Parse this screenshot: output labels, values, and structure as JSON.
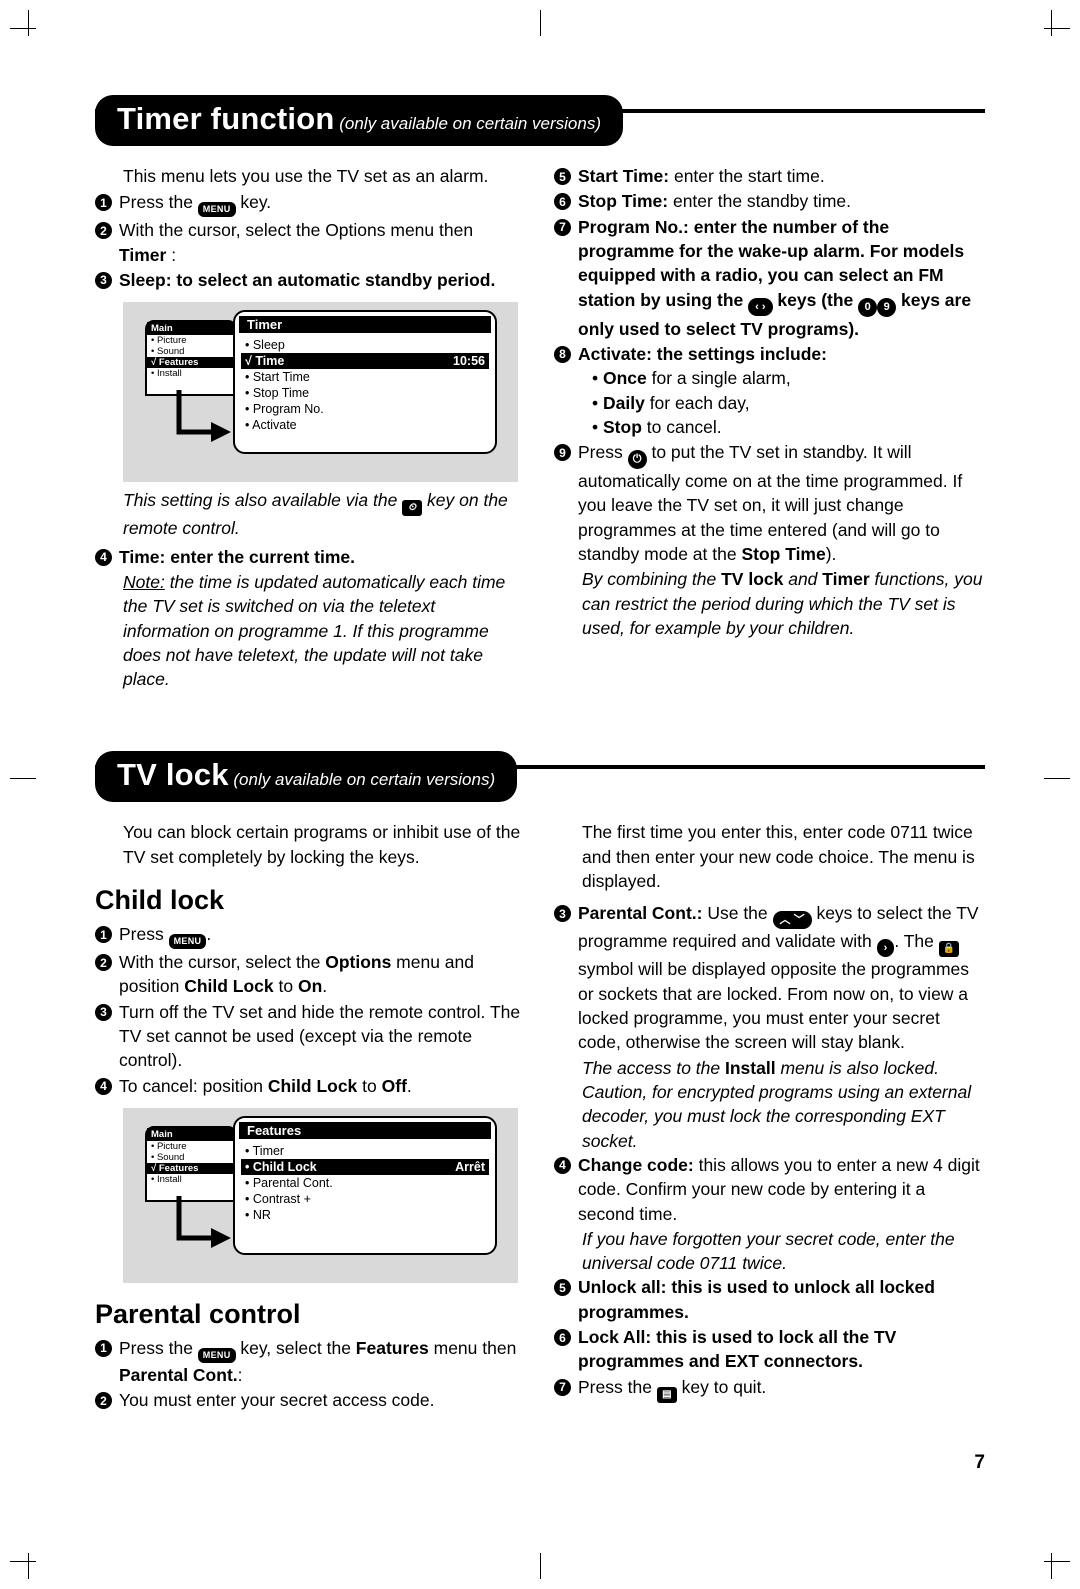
{
  "page": {
    "number": "7"
  },
  "timer": {
    "banner_title": "Timer function",
    "banner_sub": " (only available on certain versions)",
    "left": {
      "intro": "This menu lets you use the TV set as an alarm.",
      "step1_pre": "Press the ",
      "step1_key": "MENU",
      "step1_post": " key.",
      "step2": "With the cursor, select the Options menu then",
      "step2_bold": "Timer",
      "step2_colon": " :",
      "step3_bold": "Sleep:",
      "step3_rest": " to select an automatic standby period.",
      "osd": {
        "left_header": "Main",
        "left_rows": [
          "• Picture",
          "• Sound",
          "√ Features",
          "• Install"
        ],
        "left_selected_index": 2,
        "right_header": "Timer",
        "right_rows": [
          {
            "label": "• Sleep",
            "value": "",
            "selected": false
          },
          {
            "label": "√ Time",
            "value": "10:56",
            "selected": true
          },
          {
            "label": "• Start Time",
            "value": "",
            "selected": false
          },
          {
            "label": "• Stop Time",
            "value": "",
            "selected": false
          },
          {
            "label": "• Program No.",
            "value": "",
            "selected": false
          },
          {
            "label": "• Activate",
            "value": "",
            "selected": false
          }
        ]
      },
      "note_italic_1": "This setting is also available via the ",
      "note_italic_2": " key on the remote control.",
      "step4_bold": "Time:",
      "step4_rest": " enter the current time.",
      "note_label": "Note:",
      "note_text": " the time is updated automatically each time the TV set is switched on via the teletext information on programme 1. If this programme does not have teletext, the update will not take place."
    },
    "right": {
      "step5_bold": "Start Time:",
      "step5_rest": " enter the start time.",
      "step6_bold": "Stop Time:",
      "step6_rest": " enter the standby time.",
      "step7_bold": "Program No.:",
      "step7_rest_a": " enter the number of the programme for the wake-up alarm. For models equipped with a radio, you can select an FM station by using the ",
      "step7_rest_b": " keys (the ",
      "step7_key_0": "0",
      "step7_key_9": "9",
      "step7_rest_c": " keys are only used to select TV programs).",
      "step8_bold": "Activate:",
      "step8_rest": " the settings include:",
      "step8_b1_bold": "Once",
      "step8_b1_rest": " for a single alarm,",
      "step8_b2_bold": "Daily",
      "step8_b2_rest": " for each day,",
      "step8_b3_bold": "Stop",
      "step8_b3_rest": " to cancel.",
      "step9_pre": "Press ",
      "step9_post_a": " to put the TV set in standby. It will automatically come on at the time programmed. If you leave the TV set on, it will just change programmes at the time entered (and will go to standby mode at the ",
      "step9_bold": "Stop Time",
      "step9_post_b": ").",
      "closing_a": "By combining the ",
      "closing_b1": "TV lock",
      "closing_c": " and ",
      "closing_b2": "Timer",
      "closing_d": " functions, you can restrict the period during which the TV set is used, for example by your children."
    }
  },
  "tvlock": {
    "banner_title": "TV lock",
    "banner_sub": " (only available on certain versions)",
    "left": {
      "intro": "You can block certain programs or inhibit use of the TV set completely by locking the keys.",
      "child_lock_heading": "Child lock",
      "cl_step1_pre": "Press ",
      "cl_step1_key": "MENU",
      "cl_step1_post": ".",
      "cl_step2_a": "With the cursor, select the ",
      "cl_step2_b1": "Options",
      "cl_step2_b": " menu and position ",
      "cl_step2_b2": "Child Lock",
      "cl_step2_c": " to ",
      "cl_step2_b3": "On",
      "cl_step2_d": ".",
      "cl_step3": "Turn off the TV set and hide the remote control. The TV set cannot be used (except via the remote control).",
      "cl_step4_a": "To cancel: position ",
      "cl_step4_b1": "Child Lock",
      "cl_step4_b": " to ",
      "cl_step4_b2": "Off",
      "cl_step4_c": ".",
      "osd": {
        "left_header": "Main",
        "left_rows": [
          "• Picture",
          "• Sound",
          "√ Features",
          "• Install"
        ],
        "left_selected_index": 2,
        "right_header": "Features",
        "right_rows": [
          {
            "label": "• Timer",
            "value": "",
            "selected": false
          },
          {
            "label": "• Child Lock",
            "value": "Arrêt",
            "selected": true
          },
          {
            "label": "• Parental Cont.",
            "value": "",
            "selected": false
          },
          {
            "label": "• Contrast +",
            "value": "",
            "selected": false
          },
          {
            "label": "• NR",
            "value": "",
            "selected": false
          }
        ]
      },
      "parental_heading": "Parental control",
      "pc_step1_a": "Press the ",
      "pc_step1_key": "MENU",
      "pc_step1_b": " key, select the ",
      "pc_step1_b1": "Features",
      "pc_step1_c": " menu then ",
      "pc_step1_b2": "Parental Cont.",
      "pc_step1_d": ":",
      "pc_step2": "You must enter your secret access code."
    },
    "right": {
      "intro": "The first time you enter this, enter code 0711 twice and then enter your new code choice. The menu is displayed.",
      "step3_bold": "Parental Cont.:",
      "step3_a": " Use the ",
      "step3_b": " keys to select the TV programme required and validate with ",
      "step3_c": ". The ",
      "step3_d": " symbol will be displayed opposite the programmes or sockets that are locked. From now on, to view a locked programme, you must enter your secret code, otherwise the screen will stay blank.",
      "italic_a": "The access to the ",
      "italic_b1": "Install",
      "italic_b": " menu is also locked. Caution, for encrypted programs using an external decoder, you must lock the corresponding EXT socket.",
      "step4_bold": "Change code:",
      "step4_rest": " this allows you to enter a new 4 digit code. Confirm your new code by entering it a second time.",
      "italic2": "If you have forgotten your secret code, enter the universal code 0711 twice.",
      "step5_bold": "Unlock all:",
      "step5_rest": " this is used to unlock all locked programmes.",
      "step6_bold": "Lock All:",
      "step6_rest": " this is used to lock all the TV programmes and EXT connectors.",
      "step7_pre": "Press the ",
      "step7_post": " key to quit."
    }
  },
  "icons": {
    "menu": "MENU",
    "standby": "⏻",
    "sleep_key": "⏲",
    "exit_key": "▤",
    "lock": "🔒",
    "left_right": "‹ ›",
    "up_down": "︿ ﹀"
  }
}
